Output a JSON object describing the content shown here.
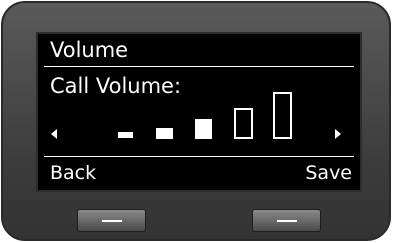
{
  "screen": {
    "title": "Volume",
    "subtitle": "Call Volume:",
    "volume": {
      "level": 3,
      "max": 5
    }
  },
  "softkeys": {
    "left_label": "Back",
    "right_label": "Save"
  },
  "icons": {
    "left_arrow": "triangle-left",
    "right_arrow": "triangle-right",
    "hw_key_mark": "dash"
  },
  "colors": {
    "screen_bg": "#000000",
    "screen_fg": "#ffffff",
    "bezel": "#444444"
  }
}
